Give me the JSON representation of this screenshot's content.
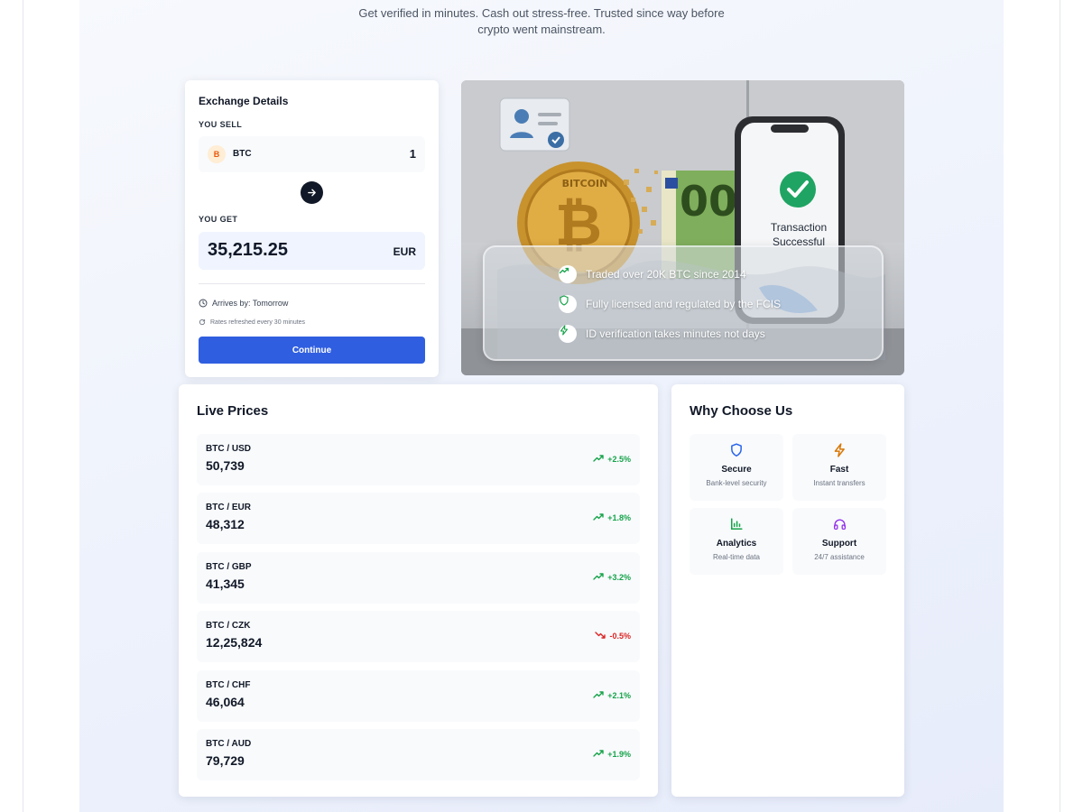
{
  "hero": {
    "subtitle_line1": "Get verified in minutes. Cash out stress-free. Trusted since way before",
    "subtitle_line2": "crypto went mainstream."
  },
  "exchange": {
    "title": "Exchange Details",
    "you_sell_label": "YOU SELL",
    "sell_coin_symbol": "B",
    "sell_coin": "BTC",
    "sell_amount": "1",
    "you_get_label": "YOU GET",
    "get_amount": "35,215.25",
    "get_currency": "EUR",
    "arrives": "Arrives by: Tomorrow",
    "refresh_note": "Rates refreshed every 30 minutes",
    "continue_label": "Continue"
  },
  "image_panel": {
    "phone_text_line1": "Transaction",
    "phone_text_line2": "Successful",
    "banknote_text": "00",
    "coin_text": "BITCOIN",
    "features": [
      {
        "icon": "trending-up-icon",
        "text": "Traded over 20K BTC since 2014"
      },
      {
        "icon": "shield-icon",
        "text": "Fully licensed and regulated by the FCIS"
      },
      {
        "icon": "lightning-icon",
        "text": "ID verification takes minutes not days"
      }
    ]
  },
  "live_prices": {
    "title": "Live Prices",
    "rows": [
      {
        "pair": "BTC / USD",
        "price": "50,739",
        "change": "+2.5%",
        "direction": "up"
      },
      {
        "pair": "BTC / EUR",
        "price": "48,312",
        "change": "+1.8%",
        "direction": "up"
      },
      {
        "pair": "BTC / GBP",
        "price": "41,345",
        "change": "+3.2%",
        "direction": "up"
      },
      {
        "pair": "BTC / CZK",
        "price": "12,25,824",
        "change": "-0.5%",
        "direction": "down"
      },
      {
        "pair": "BTC / CHF",
        "price": "46,064",
        "change": "+2.1%",
        "direction": "up"
      },
      {
        "pair": "BTC / AUD",
        "price": "79,729",
        "change": "+1.9%",
        "direction": "up"
      }
    ]
  },
  "why": {
    "title": "Why Choose Us",
    "tiles": [
      {
        "icon": "shield-icon",
        "title": "Secure",
        "desc": "Bank-level security",
        "color": "#2563eb"
      },
      {
        "icon": "lightning-icon",
        "title": "Fast",
        "desc": "Instant transfers",
        "color": "#d97706"
      },
      {
        "icon": "bar-chart-icon",
        "title": "Analytics",
        "desc": "Real-time data",
        "color": "#16a34a"
      },
      {
        "icon": "headphones-icon",
        "title": "Support",
        "desc": "24/7 assistance",
        "color": "#9333ea"
      }
    ]
  },
  "colors": {
    "accent": "#2f5ee0",
    "up": "#16a34a",
    "down": "#dc2626"
  }
}
